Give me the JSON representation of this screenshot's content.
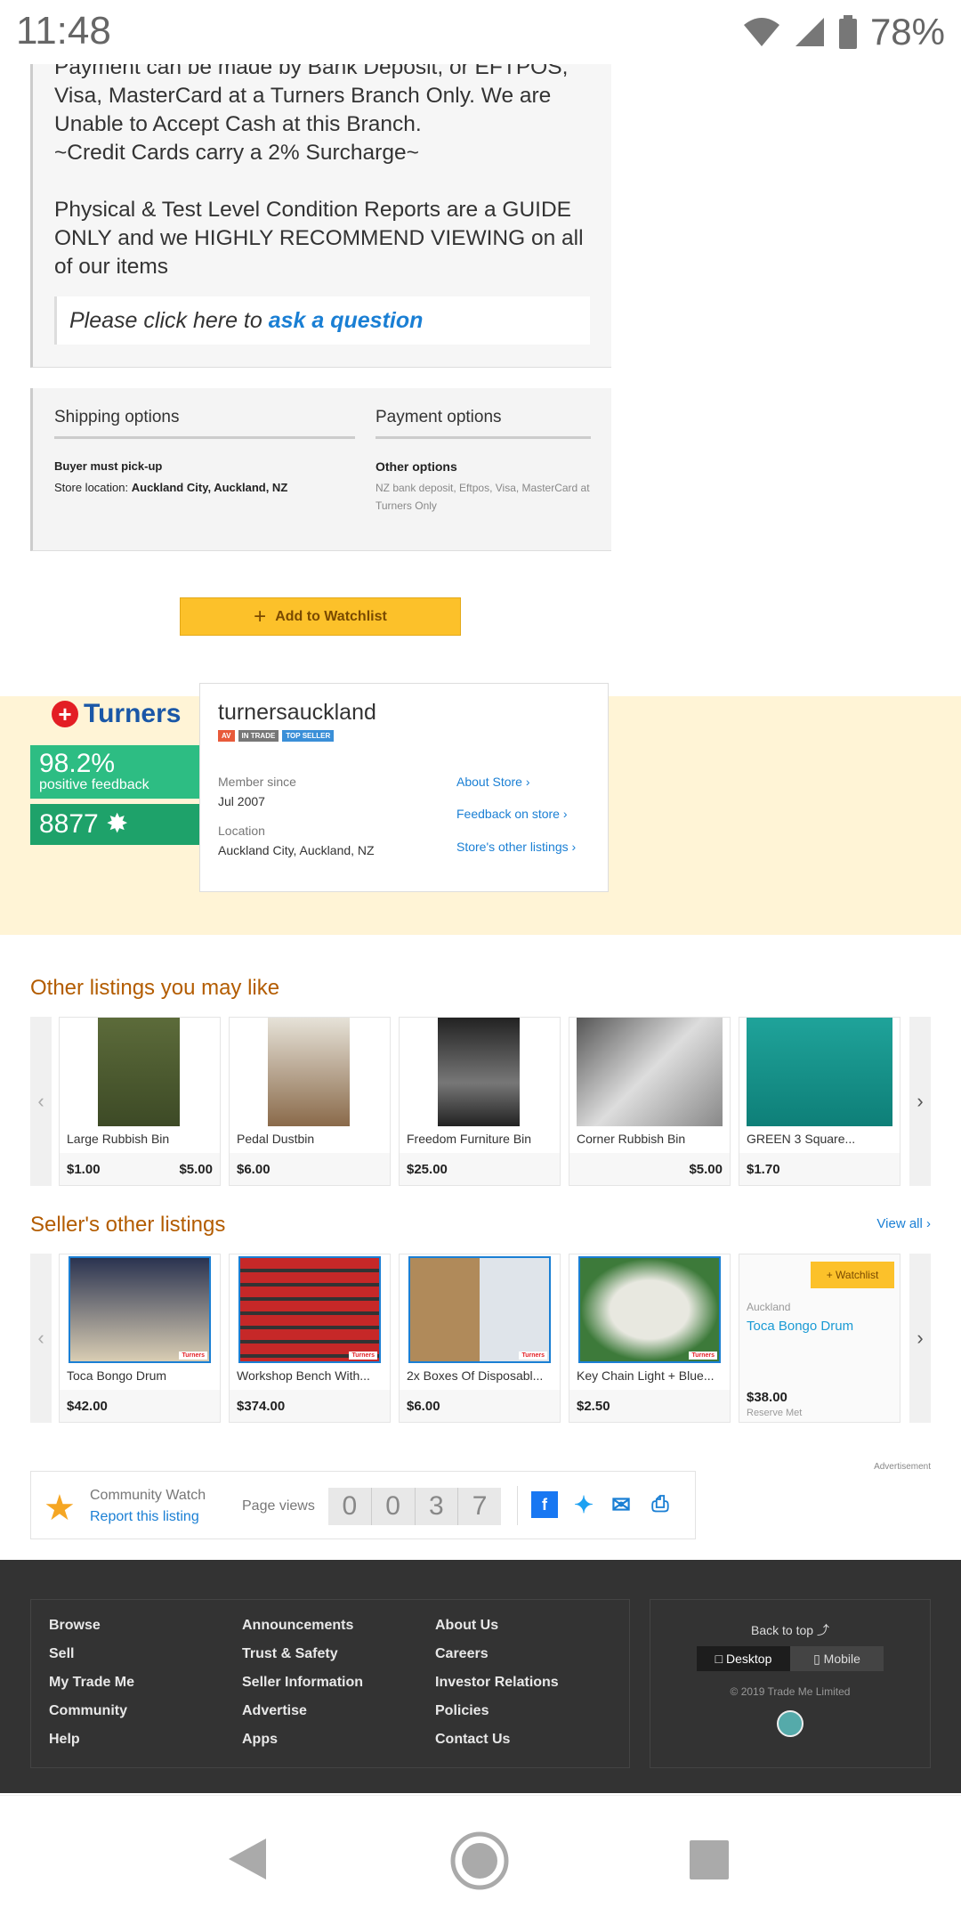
{
  "status": {
    "time": "11:48",
    "battery": "78%"
  },
  "description": {
    "para1": "Payment can be made by Bank Deposit, or EFTPOS, Visa, MasterCard at a Turners Branch Only. We are Unable to Accept Cash at this Branch.",
    "para1b": "~Credit Cards carry a 2% Surcharge~",
    "para2": "Physical & Test Level Condition Reports are a GUIDE ONLY and we HIGHLY RECOMMEND VIEWING on all of our items",
    "ask_prefix": "Please click here to",
    "ask_link": "ask a question"
  },
  "shipping": {
    "heading": "Shipping options",
    "pickup": "Buyer must pick-up",
    "store_label": "Store location:",
    "store_value": "Auckland City, Auckland, NZ"
  },
  "payment": {
    "heading": "Payment options",
    "other": "Other options",
    "methods": "NZ bank deposit, Eftpos, Visa, MasterCard at Turners Only"
  },
  "watchlist_button": "Add to Watchlist",
  "seller": {
    "logo_text": "Turners",
    "feedback_pct": "98.2%",
    "feedback_label": "positive feedback",
    "feedback_count": "8877",
    "name": "turnersauckland",
    "badges": [
      "AV",
      "IN TRADE",
      "TOP SELLER"
    ],
    "member_since_label": "Member since",
    "member_since": "Jul 2007",
    "location_label": "Location",
    "location": "Auckland City, Auckland, NZ",
    "links": [
      "About Store",
      "Feedback on store",
      "Store's other listings"
    ]
  },
  "other_listings": {
    "title": "Other listings you may like",
    "items": [
      {
        "title": "Large Rubbish Bin",
        "price": "$1.00",
        "price2": "$5.00"
      },
      {
        "title": "Pedal Dustbin",
        "price": "$6.00",
        "price2": ""
      },
      {
        "title": "Freedom Furniture Bin",
        "price": "$25.00",
        "price2": ""
      },
      {
        "title": "Corner Rubbish Bin",
        "price": "",
        "price2": "$5.00"
      },
      {
        "title": "GREEN 3 Square...",
        "price": "$1.70",
        "price2": ""
      }
    ]
  },
  "seller_listings": {
    "title": "Seller's other listings",
    "view_all": "View all",
    "items": [
      {
        "title": "Toca Bongo Drum",
        "price": "$42.00"
      },
      {
        "title": "Workshop Bench With...",
        "price": "$374.00"
      },
      {
        "title": "2x Boxes Of Disposabl...",
        "price": "$6.00"
      },
      {
        "title": "Key Chain Light + Blue...",
        "price": "$2.50"
      }
    ],
    "hover_item": {
      "watchlist": "Watchlist",
      "location": "Auckland",
      "title": "Toca Bongo Drum",
      "price": "$38.00",
      "reserve": "Reserve Met"
    },
    "img_tag": "Turners"
  },
  "community": {
    "title": "Community Watch",
    "report": "Report this listing",
    "page_views_label": "Page views",
    "digits": [
      "0",
      "0",
      "3",
      "7"
    ],
    "advertisement": "Advertisement"
  },
  "footer": {
    "col1": [
      "Browse",
      "Sell",
      "My Trade Me",
      "Community",
      "Help"
    ],
    "col2": [
      "Announcements",
      "Trust & Safety",
      "Seller Information",
      "Advertise",
      "Apps"
    ],
    "col3": [
      "About Us",
      "Careers",
      "Investor Relations",
      "Policies",
      "Contact Us"
    ],
    "back_to_top": "Back to top",
    "desktop": "Desktop",
    "mobile": "Mobile",
    "copyright": "© 2019 Trade Me Limited"
  }
}
